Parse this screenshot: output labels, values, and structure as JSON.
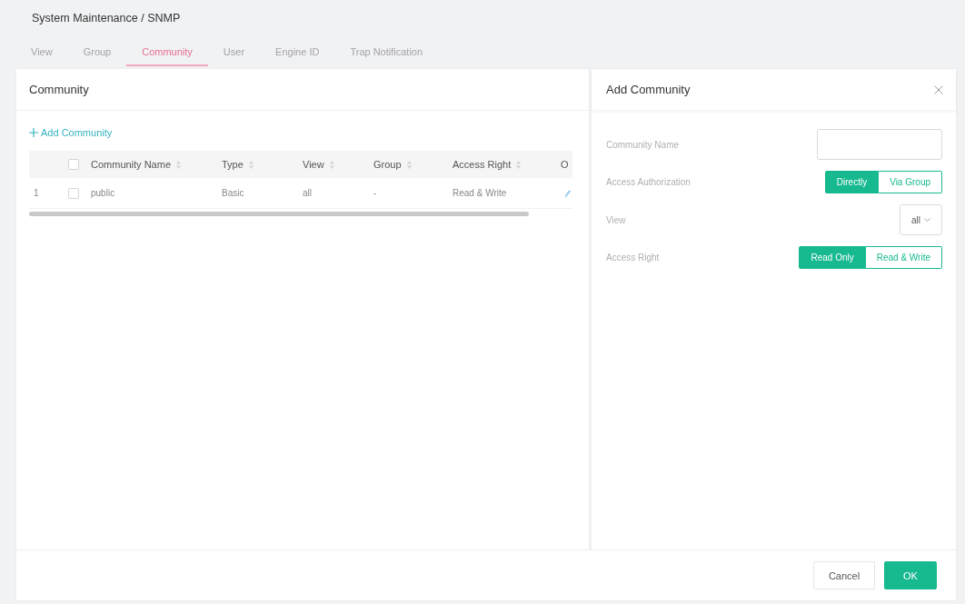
{
  "breadcrumb": "System Maintenance / SNMP",
  "tabs": [
    {
      "label": "View",
      "selected": false
    },
    {
      "label": "Group",
      "selected": false
    },
    {
      "label": "Community",
      "selected": true
    },
    {
      "label": "User",
      "selected": false
    },
    {
      "label": "Engine ID",
      "selected": false
    },
    {
      "label": "Trap Notification",
      "selected": false
    }
  ],
  "community_panel": {
    "title": "Community",
    "add_link": "Add Community",
    "table": {
      "select_all": {
        "checked": false
      },
      "columns": [
        {
          "label": "Community Name",
          "sortable": true
        },
        {
          "label": "Type",
          "sortable": true
        },
        {
          "label": "View",
          "sortable": true
        },
        {
          "label": "Group",
          "sortable": true
        },
        {
          "label": "Access Right",
          "sortable": true
        },
        {
          "label": "O",
          "sortable": false
        }
      ],
      "rows": [
        {
          "index": "1",
          "checked": false,
          "cells": [
            "public",
            "Basic",
            "all",
            "-",
            "Read & Write"
          ]
        }
      ]
    }
  },
  "add_panel": {
    "title": "Add Community",
    "fields": [
      {
        "kind": "text",
        "label": "Community Name"
      },
      {
        "kind": "segmented",
        "label": "Access Authorization",
        "options": [
          {
            "label": "Directly",
            "selected": true
          },
          {
            "label": "Via Group",
            "selected": false
          }
        ]
      },
      {
        "kind": "select",
        "label": "View",
        "value": "all"
      },
      {
        "kind": "segmented",
        "label": "Access Right",
        "options": [
          {
            "label": "Read Only",
            "selected": true
          },
          {
            "label": "Read & Write",
            "selected": false
          }
        ]
      }
    ]
  },
  "footer": {
    "buttons": [
      {
        "label": "Cancel",
        "kind": "secondary"
      },
      {
        "label": "OK",
        "kind": "primary"
      }
    ]
  }
}
